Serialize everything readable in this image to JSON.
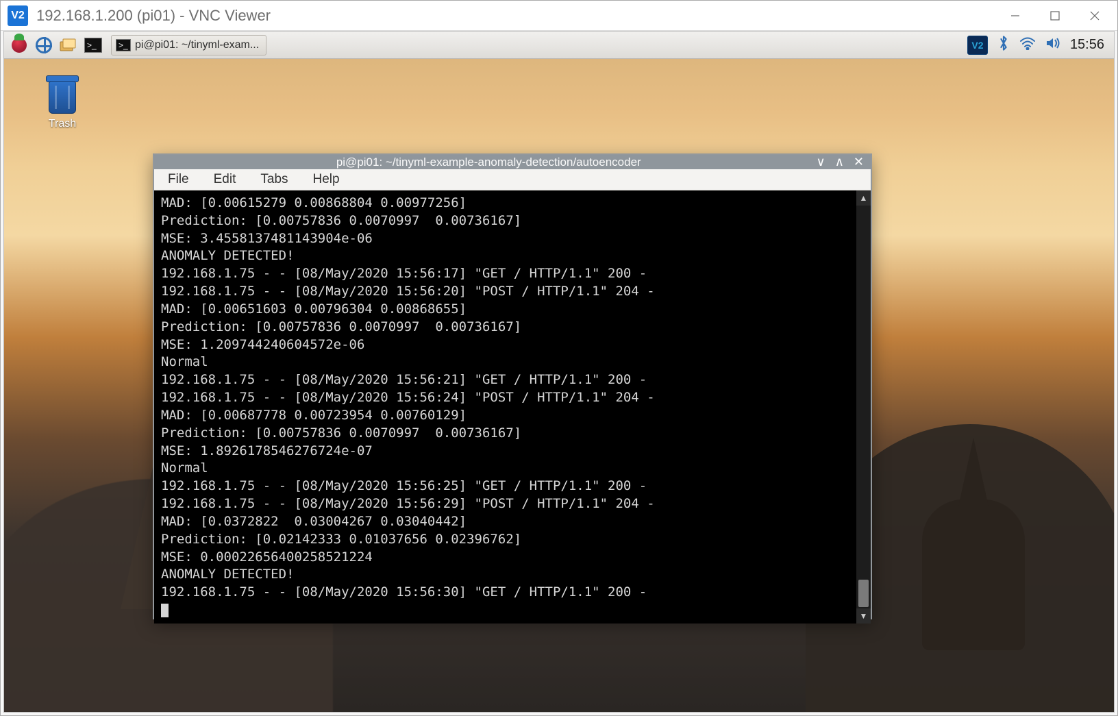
{
  "outer_window": {
    "title": "192.168.1.200 (pi01) - VNC Viewer",
    "logo_text": "V2"
  },
  "taskbar": {
    "button_label": "pi@pi01: ~/tinyml-exam...",
    "vnc_badge": "V2",
    "clock": "15:56"
  },
  "desktop": {
    "trash_label": "Trash"
  },
  "terminal": {
    "title": "pi@pi01: ~/tinyml-example-anomaly-detection/autoencoder",
    "menu": {
      "file": "File",
      "edit": "Edit",
      "tabs": "Tabs",
      "help": "Help"
    },
    "lines": [
      "MAD: [0.00615279 0.00868804 0.00977256]",
      "Prediction: [0.00757836 0.0070997  0.00736167]",
      "MSE: 3.4558137481143904e-06",
      "ANOMALY DETECTED!",
      "192.168.1.75 - - [08/May/2020 15:56:17] \"GET / HTTP/1.1\" 200 -",
      "192.168.1.75 - - [08/May/2020 15:56:20] \"POST / HTTP/1.1\" 204 -",
      "MAD: [0.00651603 0.00796304 0.00868655]",
      "Prediction: [0.00757836 0.0070997  0.00736167]",
      "MSE: 1.209744240604572e-06",
      "Normal",
      "192.168.1.75 - - [08/May/2020 15:56:21] \"GET / HTTP/1.1\" 200 -",
      "192.168.1.75 - - [08/May/2020 15:56:24] \"POST / HTTP/1.1\" 204 -",
      "MAD: [0.00687778 0.00723954 0.00760129]",
      "Prediction: [0.00757836 0.0070997  0.00736167]",
      "MSE: 1.8926178546276724e-07",
      "Normal",
      "192.168.1.75 - - [08/May/2020 15:56:25] \"GET / HTTP/1.1\" 200 -",
      "192.168.1.75 - - [08/May/2020 15:56:29] \"POST / HTTP/1.1\" 204 -",
      "MAD: [0.0372822  0.03004267 0.03040442]",
      "Prediction: [0.02142333 0.01037656 0.02396762]",
      "MSE: 0.00022656400258521224",
      "ANOMALY DETECTED!",
      "192.168.1.75 - - [08/May/2020 15:56:30] \"GET / HTTP/1.1\" 200 -"
    ]
  }
}
